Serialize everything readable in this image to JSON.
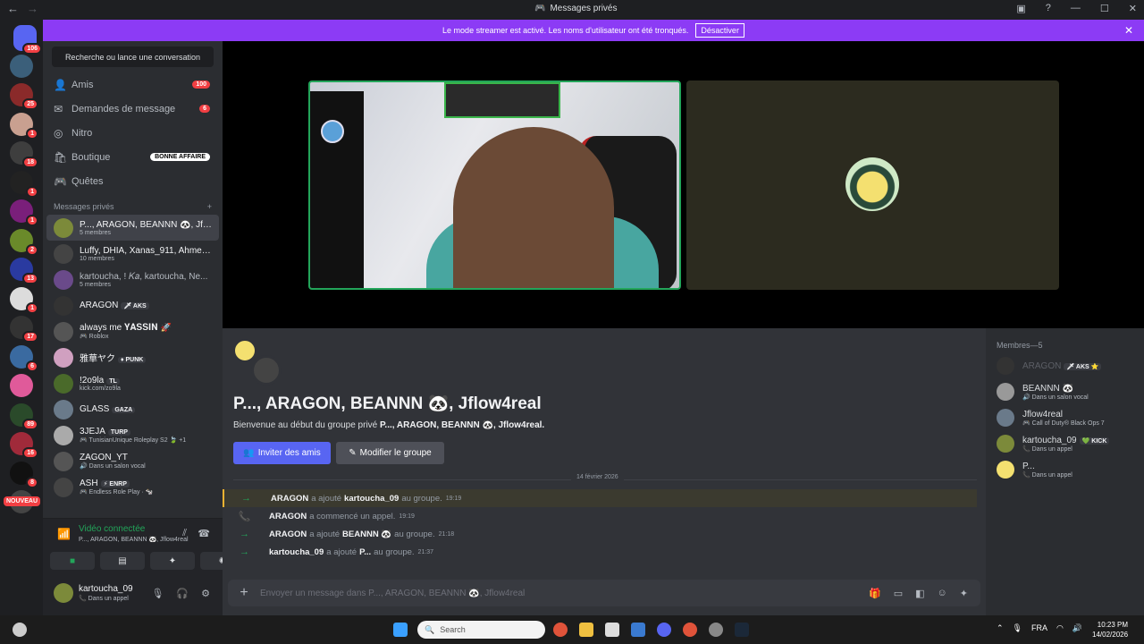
{
  "titlebar": {
    "title": "Messages privés",
    "back": "←",
    "forward": "→"
  },
  "banner": {
    "text": "Le mode streamer est activé. Les noms d'utilisateur ont été tronqués.",
    "button": "Désactiver",
    "close": "✕"
  },
  "servers": [
    {
      "badge": "106",
      "color": "#5865f2"
    },
    {
      "badge": "",
      "color": "#3b5f7a"
    },
    {
      "badge": "25",
      "color": "#8a2a2a"
    },
    {
      "badge": "1",
      "color": "#c9a090"
    },
    {
      "badge": "18",
      "color": "#3e3e3e"
    },
    {
      "badge": "1",
      "color": "#222"
    },
    {
      "badge": "1",
      "color": "#7a1f7a"
    },
    {
      "badge": "2",
      "color": "#6a8a2a"
    },
    {
      "badge": "13",
      "color": "#2a3aa0"
    },
    {
      "badge": "1",
      "color": "#dcdcdc"
    },
    {
      "badge": "17",
      "color": "#333"
    },
    {
      "badge": "6",
      "color": "#3a6aa0"
    },
    {
      "badge": "",
      "color": "#e05a9a"
    },
    {
      "badge": "89",
      "color": "#2a4a2a"
    },
    {
      "badge": "16",
      "color": "#a02a3a"
    },
    {
      "badge": "8",
      "color": "#111"
    },
    {
      "badge": "",
      "color": "#444"
    }
  ],
  "new_label": "NOUVEAU",
  "sidebar": {
    "search": "Recherche ou lance une conversation",
    "nav": [
      {
        "label": "Amis",
        "count": "100",
        "icon": "👤"
      },
      {
        "label": "Demandes de message",
        "count": "6",
        "icon": "✉"
      },
      {
        "label": "Nitro",
        "count": "",
        "icon": "◎"
      },
      {
        "label": "Boutique",
        "deal": "BONNE AFFAIRE",
        "icon": "🛍"
      },
      {
        "label": "Quêtes",
        "count": "",
        "icon": "🎮"
      }
    ],
    "dm_title": "Messages privés",
    "dm_add": "+",
    "dms": [
      {
        "name": "P..., ARAGON, BEANNN 🐼, Jfl...",
        "sub": "5 membres",
        "color": "#7c8a3a",
        "active": true
      },
      {
        "name": "Luffy, DHIA, Xanas_911, Ahmed...",
        "sub": "10 membres",
        "color": "#444"
      },
      {
        "name": "kartoucha, ! 𝐾𝑎, kartoucha, Ne...",
        "sub": "5 membres",
        "color": "#6a4a8a",
        "dim": true
      },
      {
        "name": "ARAGON",
        "tag": "🗡 AKS",
        "sub": "",
        "color": "#333"
      },
      {
        "name": "always me 𝐘𝐀𝐒𝐒𝐈𝐍 🚀",
        "sub": "🎮 Roblox",
        "color": "#555"
      },
      {
        "name": "雅華ヤク",
        "tag": "♦ PUNK",
        "sub": "",
        "color": "#d0a0c0"
      },
      {
        "name": "!2o9la",
        "tag": "TL",
        "sub": "kick.com/zo9la",
        "color": "#4a6a2a"
      },
      {
        "name": "GLASS",
        "tag": "GAZA",
        "sub": "",
        "color": "#6a7a8a"
      },
      {
        "name": "3JEJA",
        "tag": "TURP",
        "sub": "🎮 TunisianUnique Roleplay S2 🍃 +1",
        "color": "#aaa"
      },
      {
        "name": "ZAGON_YT",
        "sub": "🔊 Dans un salon vocal",
        "color": "#555"
      },
      {
        "name": "ASH",
        "tag": "⚡ ENRP",
        "sub": "🎮 Endless Role Play · 🐄",
        "color": "#444"
      }
    ]
  },
  "voice": {
    "state": "Vidéo connectée",
    "channel": "P..., ARAGON, BEANNN 🐼, Jflow4real"
  },
  "user": {
    "name": "kartoucha_09",
    "status": "📞 Dans un appel"
  },
  "chat": {
    "group_title": "P..., ARAGON, BEANNN 🐼, Jflow4real",
    "welcome_prefix": "Bienvenue au début du groupe privé",
    "welcome_name": "P..., ARAGON, BEANNN 🐼, Jflow4real.",
    "invite": "Inviter des amis",
    "edit": "Modifier le groupe",
    "date": "14 février 2026",
    "messages": [
      {
        "icon": "→",
        "actor": "ARAGON",
        "verb": "a ajouté",
        "target": "kartoucha_09",
        "tail": "au groupe.",
        "time": "19:19",
        "highlight": true
      },
      {
        "icon": "📞",
        "actor": "ARAGON",
        "verb": "a commencé un appel.",
        "target": "",
        "tail": "",
        "time": "19:19"
      },
      {
        "icon": "→",
        "actor": "ARAGON",
        "verb": "a ajouté",
        "target": "BEANNN 🐼",
        "tail": "au groupe.",
        "time": "21:18"
      },
      {
        "icon": "→",
        "actor": "kartoucha_09",
        "verb": "a ajouté",
        "target": "P...",
        "tail": "au groupe.",
        "time": "21:37"
      }
    ],
    "placeholder": "Envoyer un message dans P..., ARAGON, BEANNN 🐼, Jflow4real"
  },
  "members": {
    "title": "Membres—5",
    "list": [
      {
        "name": "ARAGON",
        "tag": "🗡 AKS ⭐",
        "sub": "",
        "color": "#333",
        "dim": true
      },
      {
        "name": "BEANNN 🐼",
        "sub": "🔊 Dans un salon vocal",
        "color": "#999"
      },
      {
        "name": "Jflow4real",
        "sub": "🎮 Call of Duty® Black Ops 7",
        "color": "#6a7a8a"
      },
      {
        "name": "kartoucha_09",
        "tag": "💚 KICK",
        "sub": "📞 Dans un appel",
        "color": "#7c8a3a"
      },
      {
        "name": "P...",
        "sub": "📞 Dans un appel",
        "color": "#f4e070"
      }
    ]
  },
  "taskbar": {
    "search": "Search",
    "lang": "FRA",
    "time": "10:23 PM",
    "date": "14/02/2026"
  }
}
